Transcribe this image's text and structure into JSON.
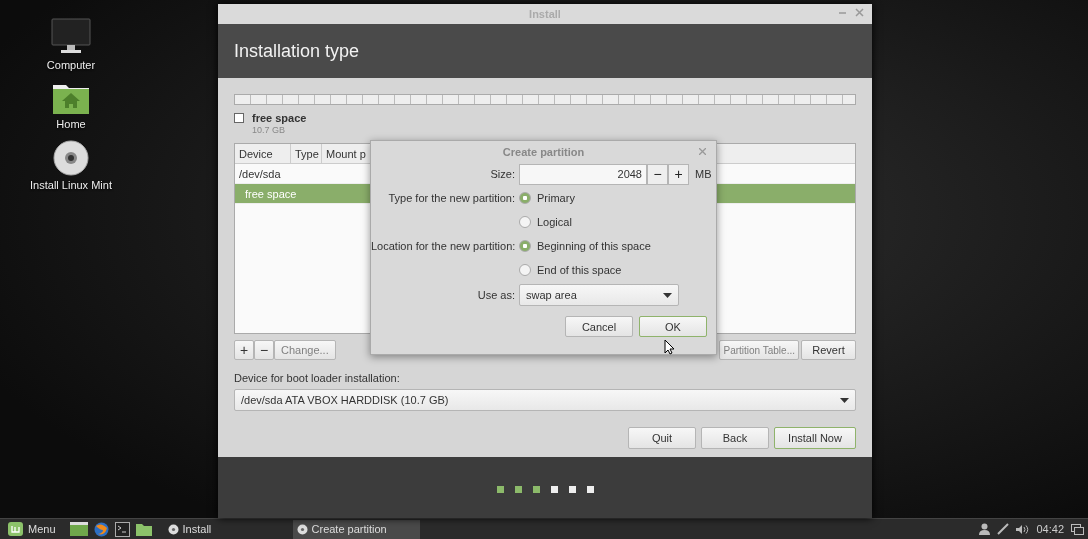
{
  "desktop_icons": [
    {
      "label": "Computer",
      "kind": "monitor"
    },
    {
      "label": "Home",
      "kind": "folder"
    },
    {
      "label": "Install Linux Mint",
      "kind": "disc"
    }
  ],
  "window": {
    "title": "Install",
    "heading": "Installation type",
    "legend": {
      "label": "free space",
      "size": "10.7 GB",
      "checked": false
    },
    "table": {
      "columns": [
        "Device",
        "Type",
        "Mount p"
      ],
      "rows": [
        {
          "device": "/dev/sda",
          "selected": false
        },
        {
          "device": "free space",
          "selected": true
        }
      ]
    },
    "table_buttons": [
      {
        "label": "+",
        "disabled": false
      },
      {
        "label": "−",
        "disabled": false
      },
      {
        "label": "Change...",
        "disabled": true
      }
    ],
    "right_buttons": [
      {
        "label": "Partition Table...",
        "disabled": true
      },
      {
        "label": "Revert",
        "disabled": false
      }
    ],
    "boot_label": "Device for boot loader installation:",
    "boot_device": "/dev/sda ATA VBOX HARDDISK (10.7 GB)",
    "actions": [
      {
        "label": "Quit",
        "default": false
      },
      {
        "label": "Back",
        "default": false
      },
      {
        "label": "Install Now",
        "default": true
      }
    ],
    "progress": [
      {
        "done": true
      },
      {
        "done": true
      },
      {
        "done": true
      },
      {
        "done": false
      },
      {
        "done": false
      },
      {
        "done": false
      }
    ]
  },
  "dialog": {
    "title": "Create partition",
    "size_label": "Size:",
    "size_value": "2048",
    "decrement": "−",
    "increment": "+",
    "size_unit": "MB",
    "groups": [
      {
        "label": "Type for the new partition:",
        "options": [
          {
            "label": "Primary",
            "selected": true
          },
          {
            "label": "Logical",
            "selected": false
          }
        ]
      },
      {
        "label": "Location for the new partition:",
        "options": [
          {
            "label": "Beginning of this space",
            "selected": true
          },
          {
            "label": "End of this space",
            "selected": false
          }
        ]
      }
    ],
    "use_as_label": "Use as:",
    "use_as_value": "swap area",
    "buttons": [
      {
        "label": "Cancel",
        "focused": false
      },
      {
        "label": "OK",
        "focused": true
      }
    ]
  },
  "taskbar": {
    "menu": "Menu",
    "tasks": [
      {
        "label": "Install",
        "selected": false
      },
      {
        "label": "Create partition",
        "selected": true
      }
    ],
    "clock": "04:42"
  }
}
